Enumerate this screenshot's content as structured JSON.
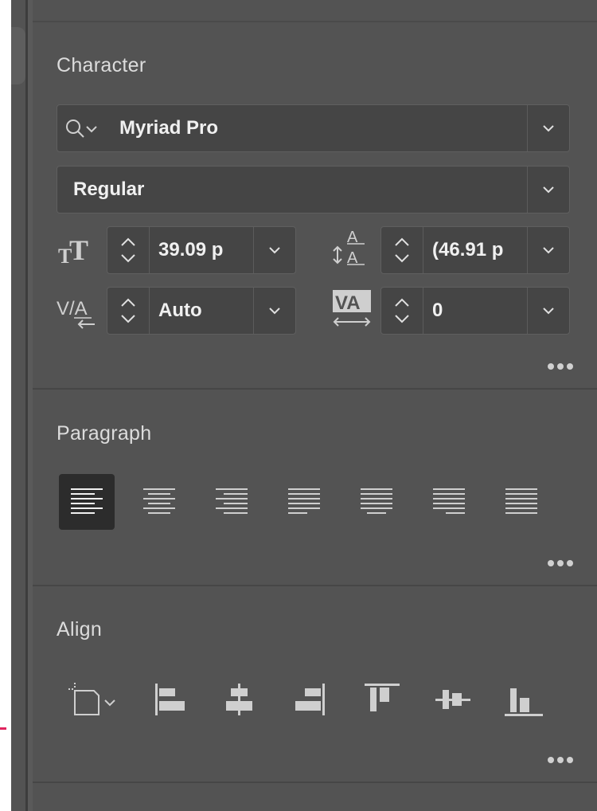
{
  "character": {
    "title": "Character",
    "font_family": "Myriad Pro",
    "font_style": "Regular",
    "font_size": "39.09 p",
    "leading": "(46.91 p",
    "kerning": "Auto",
    "tracking": "0"
  },
  "paragraph": {
    "title": "Paragraph",
    "alignments": [
      "align-left",
      "align-center",
      "align-right",
      "justify-last-left",
      "justify-last-center",
      "justify-last-right",
      "justify-all"
    ],
    "active": "align-left"
  },
  "align": {
    "title": "Align",
    "buttons": [
      "align-to-selection",
      "horizontal-align-left",
      "horizontal-align-center",
      "horizontal-align-right",
      "vertical-align-top",
      "vertical-align-center",
      "vertical-align-bottom"
    ]
  }
}
